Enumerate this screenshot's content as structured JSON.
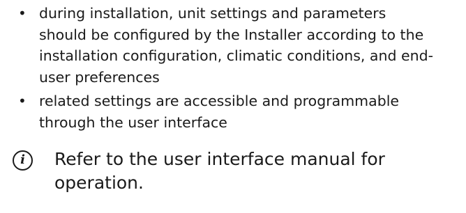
{
  "bullets": [
    {
      "lines": [
        "during installation, unit settings and parameters",
        "should be configured by the Installer according to the",
        "installation configuration, climatic conditions, and end-",
        "user preferences"
      ]
    },
    {
      "lines": [
        "related settings are accessible and programmable",
        "through the user interface"
      ]
    }
  ],
  "note": {
    "icon": "info-icon",
    "icon_glyph": "i",
    "lines": [
      "Refer to the user interface manual for",
      "operation."
    ]
  }
}
